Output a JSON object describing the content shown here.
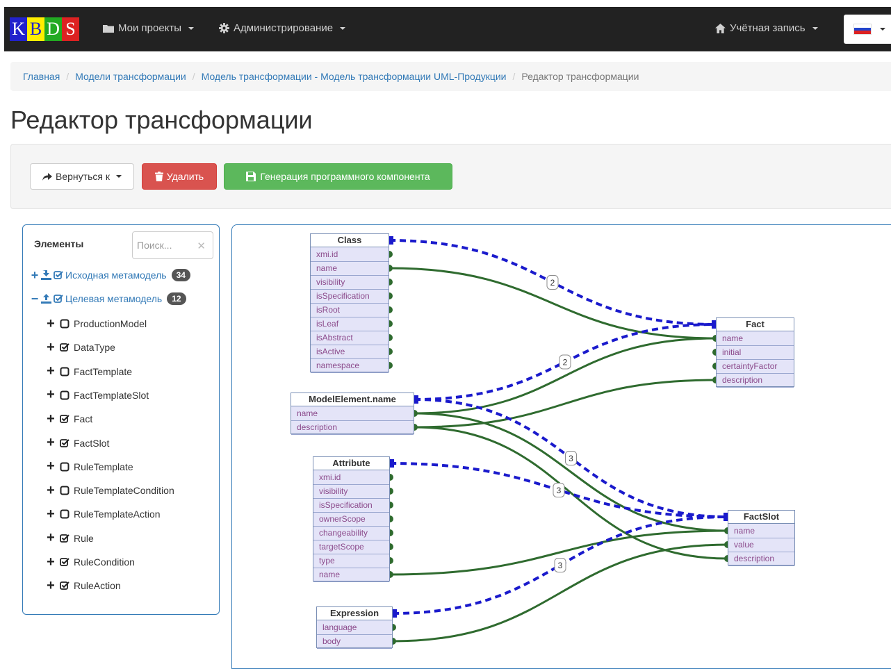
{
  "navbar": {
    "logo_letters": [
      {
        "char": "K",
        "bg": "#2222cc",
        "fg": "#ffffff"
      },
      {
        "char": "B",
        "bg": "#ffee00",
        "fg": "#2222cc"
      },
      {
        "char": "D",
        "bg": "#22aa22",
        "fg": "#ffffff"
      },
      {
        "char": "S",
        "bg": "#dd2222",
        "fg": "#ffffff"
      }
    ],
    "projects_label": "Мои проекты",
    "admin_label": "Администрирование",
    "account_label": "Учётная запись",
    "flag_colors": [
      "#ffffff",
      "#2244cc",
      "#dd2222"
    ]
  },
  "breadcrumb": [
    "Главная",
    "Модели трансформации",
    "Модель трансформации - Модель трансформации UML-Продукции",
    "Редактор трансформации"
  ],
  "page": {
    "title": "Редактор трансформации"
  },
  "toolbar": {
    "back_label": "Вернуться к",
    "delete_label": "Удалить",
    "generate_label": "Генерация программного компонента"
  },
  "panel": {
    "title": "Элементы",
    "search_placeholder": "Поиск...",
    "search_value": "",
    "roots": [
      {
        "label": "Исходная метамодель",
        "count": "34",
        "expanded": false
      },
      {
        "label": "Целевая метамодель",
        "count": "12",
        "expanded": true
      }
    ],
    "items": [
      {
        "label": "ProductionModel",
        "checked": false
      },
      {
        "label": "DataType",
        "checked": true
      },
      {
        "label": "FactTemplate",
        "checked": false
      },
      {
        "label": "FactTemplateSlot",
        "checked": false
      },
      {
        "label": "Fact",
        "checked": true
      },
      {
        "label": "FactSlot",
        "checked": true
      },
      {
        "label": "RuleTemplate",
        "checked": false
      },
      {
        "label": "RuleTemplateCondition",
        "checked": false
      },
      {
        "label": "RuleTemplateAction",
        "checked": false
      },
      {
        "label": "Rule",
        "checked": true
      },
      {
        "label": "RuleCondition",
        "checked": true
      },
      {
        "label": "RuleAction",
        "checked": true
      }
    ]
  },
  "diagram": {
    "link_color": "#2f6b2f",
    "connector_color": "#1a1acc",
    "nodes": [
      {
        "id": "class",
        "title": "Class",
        "side": "source",
        "rows": [
          "xmi.id",
          "name",
          "visibility",
          "isSpecification",
          "isRoot",
          "isLeaf",
          "isAbstract",
          "isActive",
          "namespace"
        ]
      },
      {
        "id": "modelElement",
        "title": "ModelElement.name",
        "side": "source",
        "rows": [
          "name",
          "description"
        ]
      },
      {
        "id": "attribute",
        "title": "Attribute",
        "side": "source",
        "rows": [
          "xmi.id",
          "visibility",
          "isSpecification",
          "ownerScope",
          "changeability",
          "targetScope",
          "type",
          "name"
        ]
      },
      {
        "id": "expression",
        "title": "Expression",
        "side": "source",
        "rows": [
          "language",
          "body"
        ]
      },
      {
        "id": "fact",
        "title": "Fact",
        "side": "target",
        "rows": [
          "name",
          "initial",
          "certaintyFactor",
          "description"
        ]
      },
      {
        "id": "factSlot",
        "title": "FactSlot",
        "side": "target",
        "rows": [
          "name",
          "value",
          "description"
        ]
      }
    ],
    "dashed_links": [
      {
        "from": "class",
        "to": "fact",
        "label": "2"
      },
      {
        "from": "modelElement",
        "to": "fact",
        "label": "2"
      },
      {
        "from": "modelElement",
        "to": "factSlot",
        "label": "3"
      },
      {
        "from": "attribute",
        "to": "factSlot",
        "label": "3"
      },
      {
        "from": "expression",
        "to": "factSlot",
        "label": "3"
      }
    ],
    "field_links": [
      {
        "from": "class.name",
        "to": "fact.name"
      },
      {
        "from": "modelElement.name",
        "to": "fact.name"
      },
      {
        "from": "modelElement.description",
        "to": "fact.description"
      },
      {
        "from": "modelElement.name",
        "to": "factSlot.name"
      },
      {
        "from": "modelElement.description",
        "to": "factSlot.description"
      },
      {
        "from": "attribute.name",
        "to": "factSlot.name"
      },
      {
        "from": "expression.body",
        "to": "factSlot.value"
      }
    ]
  }
}
